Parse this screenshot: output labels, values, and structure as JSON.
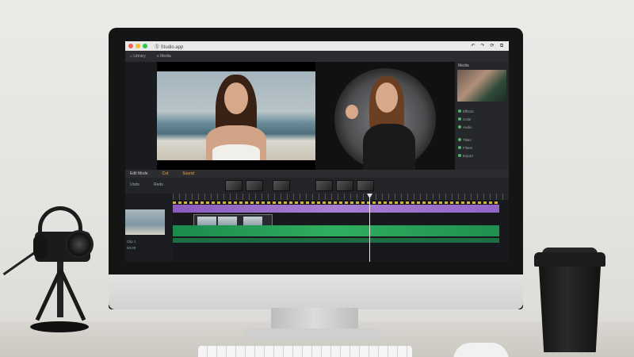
{
  "window": {
    "title": "Ⓢ Studio.app"
  },
  "toolbar": {
    "items": [
      "⌂ Library",
      "≡ Media"
    ]
  },
  "titlebar": {
    "buttons": [
      "↶",
      "↷",
      "⟳",
      "⧉"
    ]
  },
  "right_panel": {
    "title": "Media",
    "items": [
      "Effects",
      "Color",
      "Audio",
      "Titles",
      "Filters",
      "Export"
    ]
  },
  "midbar": {
    "items": [
      "Edit Mode",
      "Cut",
      "Sound"
    ]
  },
  "clipbar": {
    "buttons": [
      "Undo",
      "Redo"
    ]
  },
  "timeline_left": {
    "labels": [
      "Clip 1",
      "00:00"
    ]
  },
  "colors": {
    "accent": "#f0a83c",
    "purple_track": "#9265c7",
    "green_track": "#2fae60",
    "yellow_marker": "#d6b33a"
  }
}
